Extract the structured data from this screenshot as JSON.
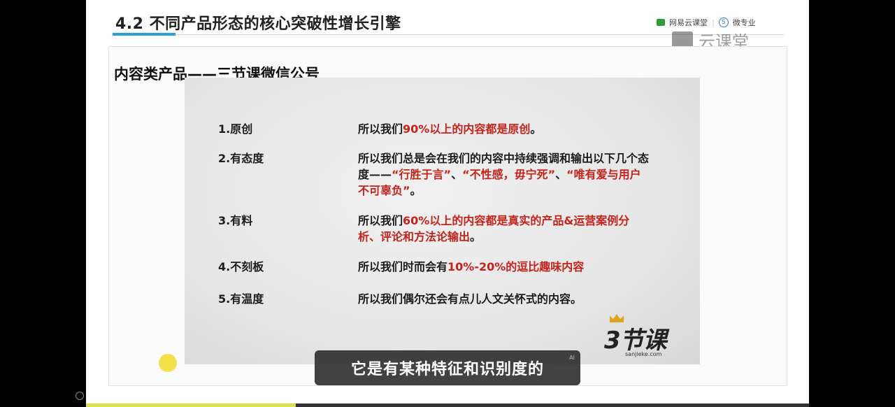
{
  "slide": {
    "title": "4.2 不同产品形态的核心突破性增长引擎",
    "brand_netease": "网易云课堂",
    "brand_micro": "微专业",
    "brand_micro_icon_letter": "S",
    "watermark": "云课堂",
    "subtitle": "内容类产品——三节课微信公号"
  },
  "items": [
    {
      "num": "1.原创",
      "parts": [
        {
          "t": "所以我们",
          "c": "black"
        },
        {
          "t": "90%以上的内容都是原创",
          "c": "red"
        },
        {
          "t": "。",
          "c": "black"
        }
      ]
    },
    {
      "num": "2.有态度",
      "parts": [
        {
          "t": "所以我们总是会在我们的内容中持续强调和输出以下几个态度——",
          "c": "black"
        },
        {
          "t": "“行胜于言”",
          "c": "red"
        },
        {
          "t": "、",
          "c": "black"
        },
        {
          "t": "“不性感，毋宁死”",
          "c": "red"
        },
        {
          "t": "、",
          "c": "black"
        },
        {
          "t": "“唯有爱与用户不可辜负”",
          "c": "red"
        },
        {
          "t": "。",
          "c": "black"
        }
      ]
    },
    {
      "num": "3.有料",
      "parts": [
        {
          "t": "所以我们",
          "c": "black"
        },
        {
          "t": "60%以上的内容都是真实的产品&运营案例分析、评论和方法论输出",
          "c": "red"
        },
        {
          "t": "。",
          "c": "black"
        }
      ]
    },
    {
      "num": "4.不刻板",
      "parts": [
        {
          "t": "所以我们时而会有",
          "c": "black"
        },
        {
          "t": "10%-20%的逗比趣味内容",
          "c": "red"
        }
      ]
    },
    {
      "num": "5.有温度",
      "parts": [
        {
          "t": "所以我们偶尔还会有点儿人文关怀式的内容。",
          "c": "black"
        }
      ]
    }
  ],
  "logo": {
    "text": "3节课",
    "url": "sanjieke.com"
  },
  "caption": {
    "text": "它是有某种特征和识别度的",
    "ai_tag": "AI"
  },
  "player": {
    "progress": 0.29
  },
  "colors": {
    "accent_red": "#c4231b",
    "title_underline": "#2aa0d8",
    "progress": "#d8e24a"
  }
}
